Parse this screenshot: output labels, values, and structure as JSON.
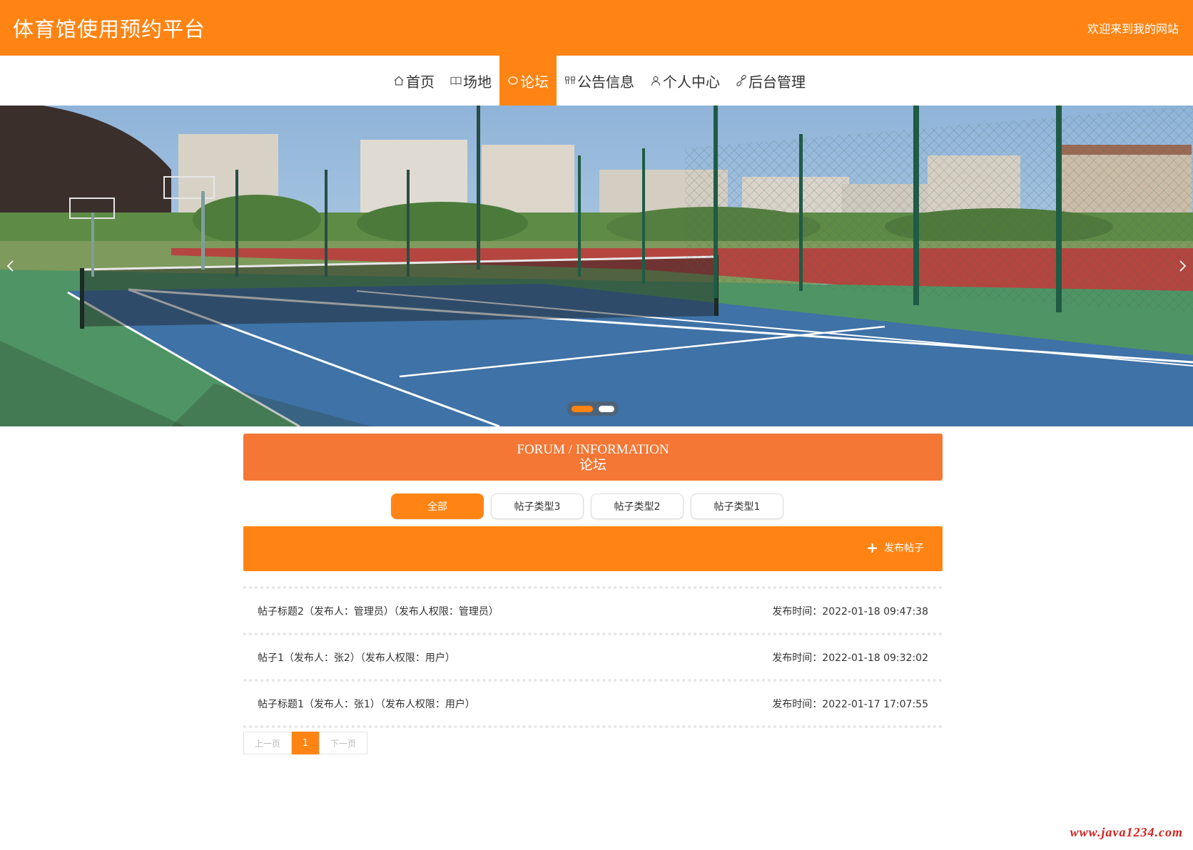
{
  "header": {
    "site_title": "体育馆使用预约平台",
    "welcome": "欢迎来到我的网站"
  },
  "nav": {
    "items": [
      {
        "label": "首页",
        "icon": "home-icon"
      },
      {
        "label": "场地",
        "icon": "book-icon"
      },
      {
        "label": "论坛",
        "icon": "forum-icon",
        "active": true
      },
      {
        "label": "公告信息",
        "icon": "notice-icon"
      },
      {
        "label": "个人中心",
        "icon": "user-icon"
      },
      {
        "label": "后台管理",
        "icon": "link-icon"
      }
    ]
  },
  "banner": {
    "slide_count": 2,
    "active_slide": 1
  },
  "forum": {
    "title_en": "FORUM / INFORMATION",
    "title_cn": "论坛"
  },
  "tabs": [
    {
      "label": "全部",
      "active": true
    },
    {
      "label": "帖子类型3"
    },
    {
      "label": "帖子类型2"
    },
    {
      "label": "帖子类型1"
    }
  ],
  "publish": {
    "label": "发布帖子"
  },
  "posts": [
    {
      "title": "帖子标题2（发布人：管理员）（发布人权限：管理员）",
      "time": "发布时间：2022-01-18 09:47:38"
    },
    {
      "title": "帖子1（发布人：张2）（发布人权限：用户）",
      "time": "发布时间：2022-01-18 09:32:02"
    },
    {
      "title": "帖子标题1（发布人：张1）（发布人权限：用户）",
      "time": "发布时间：2022-01-17 17:07:55"
    }
  ],
  "pagination": {
    "prev": "上一页",
    "current": "1",
    "next": "下一页"
  },
  "watermark": "www.java1234.com",
  "colors": {
    "primary": "#ff8414",
    "title_bar": "#f47735",
    "watermark": "#d81e1e"
  }
}
